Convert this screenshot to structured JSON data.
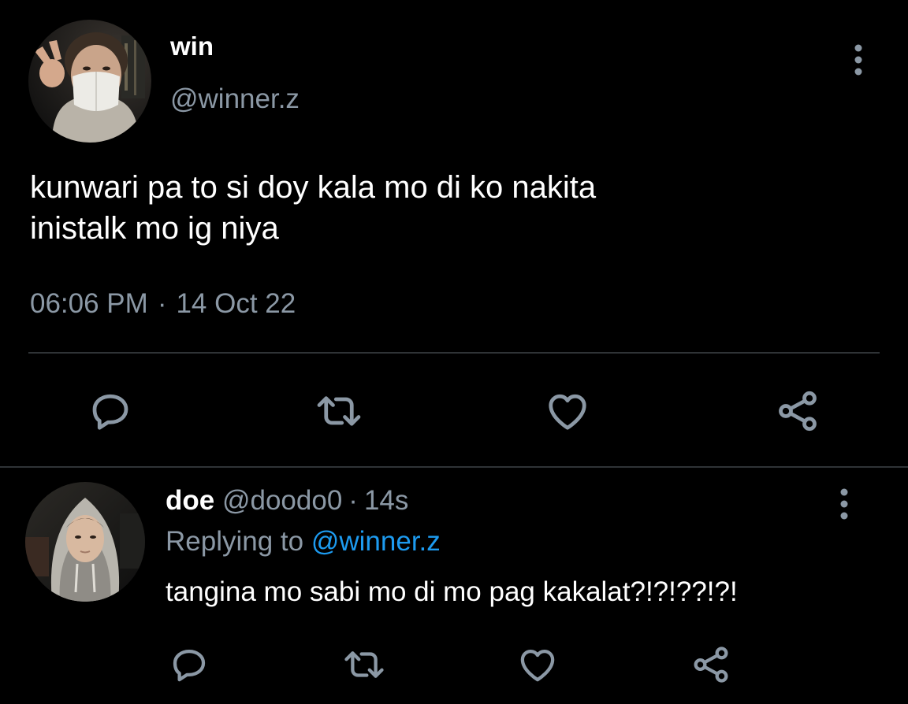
{
  "main_tweet": {
    "author_name": "win",
    "author_handle": "@winner.z",
    "text": "kunwari pa to si doy kala mo di ko nakita\ninistalk mo ig niya",
    "time": "06:06 PM",
    "separator": "·",
    "date": "14 Oct 22",
    "menu_icon": "more-vertical-icon",
    "actions": [
      "reply-icon",
      "retweet-icon",
      "like-icon",
      "share-icon"
    ]
  },
  "reply": {
    "author_name": "doe",
    "author_handle": "@doodo0",
    "separator": "·",
    "age": "14s",
    "replying_prefix": "Replying to",
    "replying_mention": "@winner.z",
    "text": "tangina mo sabi mo di mo pag kakalat?!?!??!?!",
    "menu_icon": "more-vertical-icon",
    "actions": [
      "reply-icon",
      "retweet-icon",
      "like-icon",
      "share-icon"
    ]
  },
  "colors": {
    "background": "#000000",
    "primary_text": "#ffffff",
    "secondary_text": "#8b98a5",
    "mention": "#1d9bf0",
    "divider": "#2f3336",
    "icon": "#8b98a5"
  }
}
